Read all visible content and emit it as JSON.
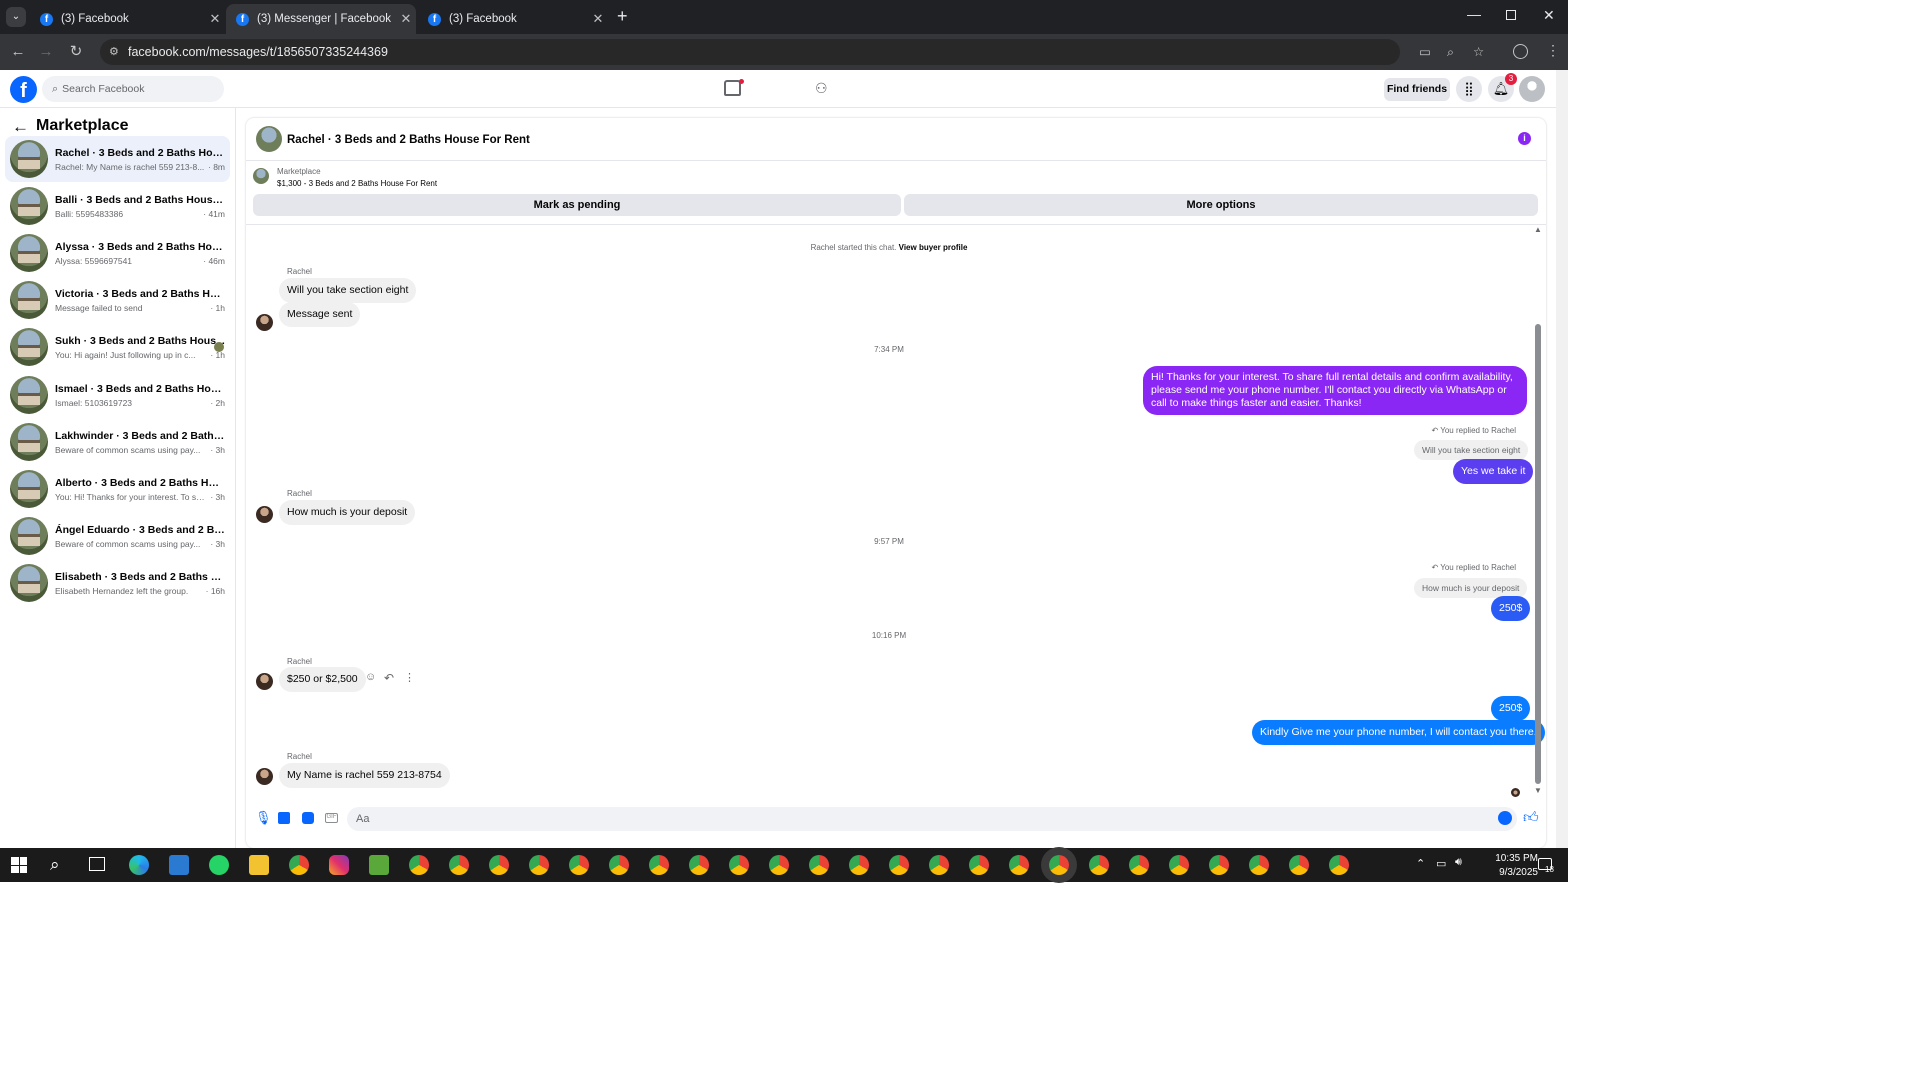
{
  "browser": {
    "tabs": [
      {
        "title": "(3) Facebook"
      },
      {
        "title": "(3) Messenger | Facebook"
      },
      {
        "title": "(3) Facebook"
      }
    ],
    "url": "facebook.com/messages/t/1856507335244369"
  },
  "header": {
    "search_placeholder": "Search Facebook",
    "find_friends": "Find friends",
    "notification_count": "3"
  },
  "sidebar": {
    "title": "Marketplace",
    "conversations": [
      {
        "name": "Rachel · 3 Beds and 2 Baths House...",
        "preview": "Rachel: My Name is rachel 559 213-8...",
        "time": "· 8m"
      },
      {
        "name": "Balli · 3 Beds and 2 Baths House F...",
        "preview": "Balli: 5595483386",
        "time": "· 41m"
      },
      {
        "name": "Alyssa · 3 Beds and 2 Baths House ...",
        "preview": "Alyssa: 5596697541",
        "time": "· 46m"
      },
      {
        "name": "Victoria · 3 Beds and 2 Baths Hous...",
        "preview": "Message failed to send",
        "time": "· 1h"
      },
      {
        "name": "Sukh · 3 Beds and 2 Baths Hous...",
        "preview": "You: Hi again! Just following up in c...",
        "time": "· 1h"
      },
      {
        "name": "Ismael · 3 Beds and 2 Baths House...",
        "preview": "Ismael: 5103619723",
        "time": "· 2h"
      },
      {
        "name": "Lakhwinder · 3 Beds and 2 Baths H...",
        "preview": "Beware of common scams using pay...",
        "time": "· 3h"
      },
      {
        "name": "Alberto · 3 Beds and 2 Baths Hous...",
        "preview": "You: Hi! Thanks for your interest. To sh...",
        "time": "· 3h"
      },
      {
        "name": "Ángel Eduardo · 3 Beds and 2 Bath...",
        "preview": "Beware of common scams using pay...",
        "time": "· 3h"
      },
      {
        "name": "Elisabeth · 3 Beds and 2 Baths Hou...",
        "preview": "Elisabeth Hernandez left the group.",
        "time": "· 16h"
      }
    ]
  },
  "chat": {
    "title": "Rachel · 3 Beds and 2 Baths House For Rent",
    "listing_source": "Marketplace",
    "listing": "$1,300 - 3 Beds and 2 Baths House For Rent",
    "mark_pending": "Mark as pending",
    "more_options": "More options",
    "started": "Rachel started this chat.",
    "view_profile": "View buyer profile",
    "sender": "Rachel",
    "messages": {
      "m1": "Will you take section eight",
      "m2": "Message sent",
      "t1": "7:34 PM",
      "m3": "Hi! Thanks for your interest. To share full rental details and confirm availability, please send me your phone number. I'll contact you directly via WhatsApp or call to make things faster and easier. Thanks!",
      "reply1": "You replied to Rachel",
      "quote1": "Will you take section eight",
      "m4": "Yes we take it",
      "m5": "How much is your deposit",
      "t2": "9:57 PM",
      "reply2": "You replied to Rachel",
      "quote2": "How much is your deposit",
      "m6": "250$",
      "t3": "10:16 PM",
      "m7": "$250 or $2,500",
      "m8": "250$",
      "m9": "Kindly Give me your phone number, I will contact you there.",
      "m10": "My Name is rachel 559 213-8754"
    },
    "composer_placeholder": "Aa"
  },
  "taskbar": {
    "time": "10:35 PM",
    "date": "9/3/2025",
    "notif": "18"
  },
  "colors": {
    "fb_blue": "#0866ff",
    "bubble_out": "#0a7cff",
    "bubble_purple": "#8b27f5"
  }
}
